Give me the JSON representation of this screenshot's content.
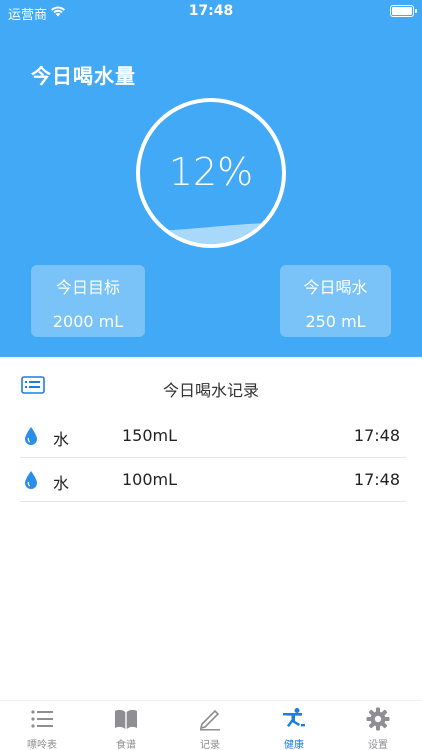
{
  "status_bar": {
    "carrier": "运营商",
    "time": "17:48"
  },
  "header": {
    "title": "今日喝水量",
    "progress_percent_text": "12%",
    "progress_fraction": 0.12
  },
  "cards": {
    "goal": {
      "label": "今日目标",
      "value": "2000 mL"
    },
    "drunk": {
      "label": "今日喝水",
      "value": "250 mL"
    }
  },
  "records": {
    "title": "今日喝水记录",
    "items": [
      {
        "name": "水",
        "amount": "150mL",
        "time": "17:48"
      },
      {
        "name": "水",
        "amount": "100mL",
        "time": "17:48"
      }
    ]
  },
  "tabs": [
    {
      "label": "嘌呤表",
      "icon": "list-icon",
      "active": false
    },
    {
      "label": "食谱",
      "icon": "book-icon",
      "active": false
    },
    {
      "label": "记录",
      "icon": "pencil-icon",
      "active": false
    },
    {
      "label": "健康",
      "icon": "exercise-icon",
      "active": true
    },
    {
      "label": "设置",
      "icon": "gear-icon",
      "active": false
    }
  ],
  "colors": {
    "primary": "#41a9f5",
    "active_tab": "#1a7fe0",
    "water": "#9fd4fb"
  }
}
